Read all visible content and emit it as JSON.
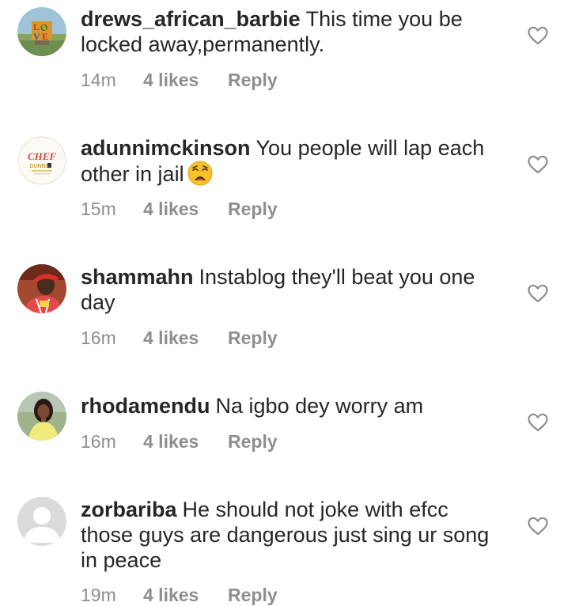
{
  "comments": [
    {
      "username": "drews_african_barbie",
      "text": "This time you be locked away,permanently.",
      "time": "14m",
      "likes": "4 likes",
      "reply": "Reply",
      "avatar_icon": "love-sculpture-avatar"
    },
    {
      "username": "adunnimckinson",
      "text": "You people will lap each other in jail",
      "emoji": "weary-face-emoji",
      "time": "15m",
      "likes": "4 likes",
      "reply": "Reply",
      "avatar_icon": "chef-dunns-logo-avatar",
      "avatar_logo_text": "CHEF DUNNS"
    },
    {
      "username": "shammahn",
      "text": "Instablog they'll beat you one day",
      "time": "16m",
      "likes": "4 likes",
      "reply": "Reply",
      "avatar_icon": "person-red-cap-avatar"
    },
    {
      "username": "rhodamendu",
      "text": "Na igbo dey worry am",
      "time": "16m",
      "likes": "4 likes",
      "reply": "Reply",
      "avatar_icon": "woman-yellow-top-avatar"
    },
    {
      "username": "zorbariba",
      "text": "He should not joke with efcc those guys are dangerous just sing ur song in peace",
      "time": "19m",
      "likes": "4 likes",
      "reply": "Reply",
      "avatar_icon": "default-profile-avatar"
    }
  ],
  "colors": {
    "text": "#262626",
    "meta": "#8e8e8e",
    "heart": "#8e8e8e",
    "default_avatar": "#dbdbdb"
  }
}
